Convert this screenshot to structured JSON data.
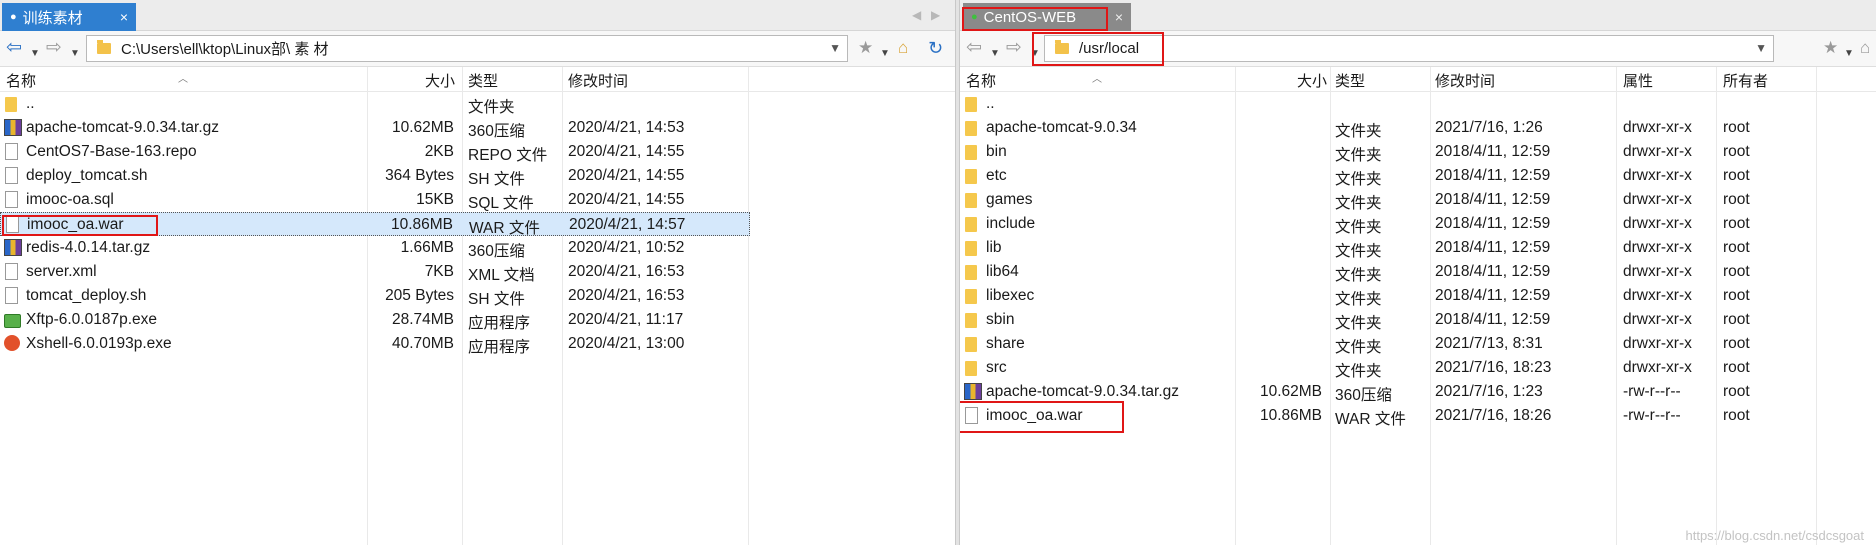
{
  "left": {
    "tab": {
      "label": "训练素材",
      "close": "×",
      "nav_prev": "◀",
      "nav_next": "▶"
    },
    "path": "C:\\Users\\ell\\ktop\\Linux部\\ 素 材",
    "columns": {
      "name": "名称",
      "size": "大小",
      "type": "类型",
      "mtime": "修改时间"
    },
    "files": [
      {
        "name": "..",
        "size": "",
        "type": "文件夹",
        "mtime": "",
        "icon": "folder"
      },
      {
        "name": "apache-tomcat-9.0.34.tar.gz",
        "size": "10.62MB",
        "type": "360压缩",
        "mtime": "2020/4/21, 14:53",
        "icon": "archive"
      },
      {
        "name": "CentOS7-Base-163.repo",
        "size": "2KB",
        "type": "REPO 文件",
        "mtime": "2020/4/21, 14:55",
        "icon": "document"
      },
      {
        "name": "deploy_tomcat.sh",
        "size": "364 Bytes",
        "type": "SH 文件",
        "mtime": "2020/4/21, 14:55",
        "icon": "document"
      },
      {
        "name": "imooc-oa.sql",
        "size": "15KB",
        "type": "SQL 文件",
        "mtime": "2020/4/21, 14:55",
        "icon": "document"
      },
      {
        "name": "imooc_oa.war",
        "size": "10.86MB",
        "type": "WAR 文件",
        "mtime": "2020/4/21, 14:57",
        "icon": "document"
      },
      {
        "name": "redis-4.0.14.tar.gz",
        "size": "1.66MB",
        "type": "360压缩",
        "mtime": "2020/4/21, 10:52",
        "icon": "archive"
      },
      {
        "name": "server.xml",
        "size": "7KB",
        "type": "XML 文档",
        "mtime": "2020/4/21, 16:53",
        "icon": "document"
      },
      {
        "name": "tomcat_deploy.sh",
        "size": "205 Bytes",
        "type": "SH 文件",
        "mtime": "2020/4/21, 16:53",
        "icon": "document"
      },
      {
        "name": "Xftp-6.0.0187p.exe",
        "size": "28.74MB",
        "type": "应用程序",
        "mtime": "2020/4/21, 11:17",
        "icon": "xftp-app"
      },
      {
        "name": "Xshell-6.0.0193p.exe",
        "size": "40.70MB",
        "type": "应用程序",
        "mtime": "2020/4/21, 13:00",
        "icon": "xshell-app"
      }
    ]
  },
  "right": {
    "tab": {
      "label": "CentOS-WEB",
      "close": "×"
    },
    "path": "/usr/local",
    "columns": {
      "name": "名称",
      "size": "大小",
      "type": "类型",
      "mtime": "修改时间",
      "perm": "属性",
      "owner": "所有者"
    },
    "files": [
      {
        "name": "..",
        "size": "",
        "type": "",
        "mtime": "",
        "perm": "",
        "owner": "",
        "icon": "folder"
      },
      {
        "name": "apache-tomcat-9.0.34",
        "size": "",
        "type": "文件夹",
        "mtime": "2021/7/16, 1:26",
        "perm": "drwxr-xr-x",
        "owner": "root",
        "icon": "folder"
      },
      {
        "name": "bin",
        "size": "",
        "type": "文件夹",
        "mtime": "2018/4/11, 12:59",
        "perm": "drwxr-xr-x",
        "owner": "root",
        "icon": "folder"
      },
      {
        "name": "etc",
        "size": "",
        "type": "文件夹",
        "mtime": "2018/4/11, 12:59",
        "perm": "drwxr-xr-x",
        "owner": "root",
        "icon": "folder"
      },
      {
        "name": "games",
        "size": "",
        "type": "文件夹",
        "mtime": "2018/4/11, 12:59",
        "perm": "drwxr-xr-x",
        "owner": "root",
        "icon": "folder"
      },
      {
        "name": "include",
        "size": "",
        "type": "文件夹",
        "mtime": "2018/4/11, 12:59",
        "perm": "drwxr-xr-x",
        "owner": "root",
        "icon": "folder"
      },
      {
        "name": "lib",
        "size": "",
        "type": "文件夹",
        "mtime": "2018/4/11, 12:59",
        "perm": "drwxr-xr-x",
        "owner": "root",
        "icon": "folder"
      },
      {
        "name": "lib64",
        "size": "",
        "type": "文件夹",
        "mtime": "2018/4/11, 12:59",
        "perm": "drwxr-xr-x",
        "owner": "root",
        "icon": "folder"
      },
      {
        "name": "libexec",
        "size": "",
        "type": "文件夹",
        "mtime": "2018/4/11, 12:59",
        "perm": "drwxr-xr-x",
        "owner": "root",
        "icon": "folder"
      },
      {
        "name": "sbin",
        "size": "",
        "type": "文件夹",
        "mtime": "2018/4/11, 12:59",
        "perm": "drwxr-xr-x",
        "owner": "root",
        "icon": "folder"
      },
      {
        "name": "share",
        "size": "",
        "type": "文件夹",
        "mtime": "2021/7/13, 8:31",
        "perm": "drwxr-xr-x",
        "owner": "root",
        "icon": "folder"
      },
      {
        "name": "src",
        "size": "",
        "type": "文件夹",
        "mtime": "2021/7/16, 18:23",
        "perm": "drwxr-xr-x",
        "owner": "root",
        "icon": "folder"
      },
      {
        "name": "apache-tomcat-9.0.34.tar.gz",
        "size": "10.62MB",
        "type": "360压缩",
        "mtime": "2021/7/16, 1:23",
        "perm": "-rw-r--r--",
        "owner": "root",
        "icon": "archive"
      },
      {
        "name": "imooc_oa.war",
        "size": "10.86MB",
        "type": "WAR 文件",
        "mtime": "2021/7/16, 18:26",
        "perm": "-rw-r--r--",
        "owner": "root",
        "icon": "document"
      }
    ]
  },
  "watermark": "https://blog.csdn.net/csdcsgoat"
}
